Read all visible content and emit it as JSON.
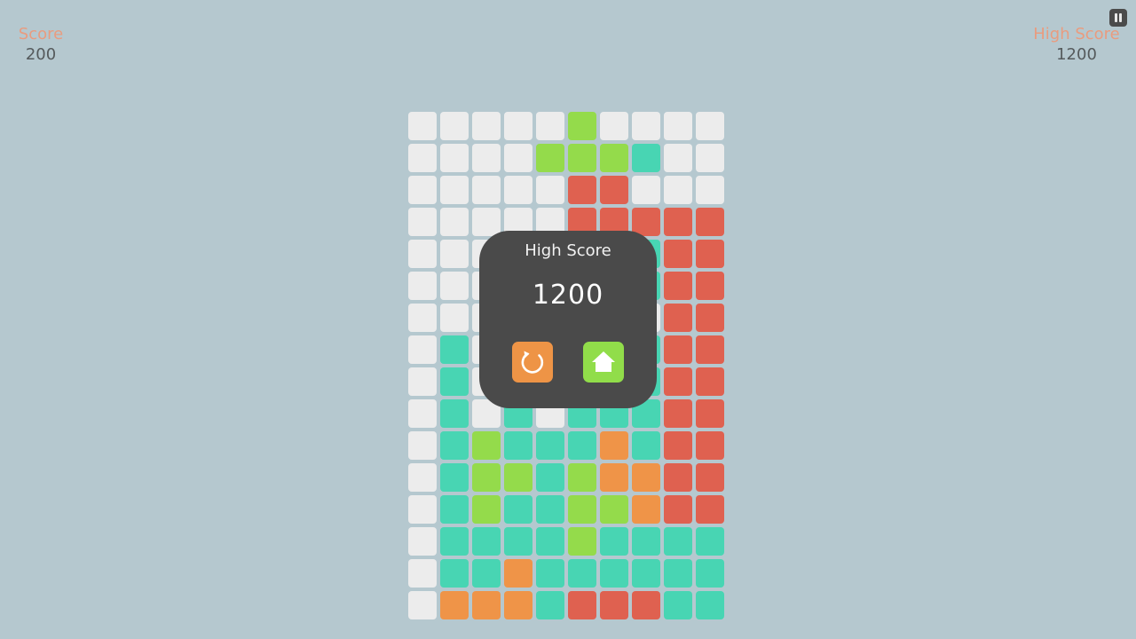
{
  "hud": {
    "score_label": "Score",
    "score_value": "200",
    "high_score_label": "High Score",
    "high_score_value": "1200",
    "pause_icon": "pause-icon"
  },
  "dialog": {
    "title": "High Score",
    "score": "1200",
    "restart_icon": "restart-icon",
    "home_icon": "home-icon"
  },
  "colors": {
    "E": "#ececec",
    "G": "#94db4b",
    "T": "#48d5b3",
    "R": "#df6150",
    "O": "#ef9448",
    "background": "#b5c8cf",
    "dialog": "#4a4a4a"
  },
  "board": {
    "columns": 10,
    "rows": [
      "EEEEEGEEEE",
      "EEEEGGGTEE",
      "EEEEERREEE",
      "EEEEERRRRR",
      "EEEEEERTRR",
      "EEEEEETTRR",
      "EEEEEEEERR",
      "ETEEEEETRR",
      "ETEEEEETRR",
      "ETETETTTRR",
      "ETGTTTOTRR",
      "ETGGTGOORR",
      "ETGTTGGORR",
      "ETTTTGTTTT",
      "ETTOTTTTTT",
      "EOOOTRRRTT"
    ]
  }
}
